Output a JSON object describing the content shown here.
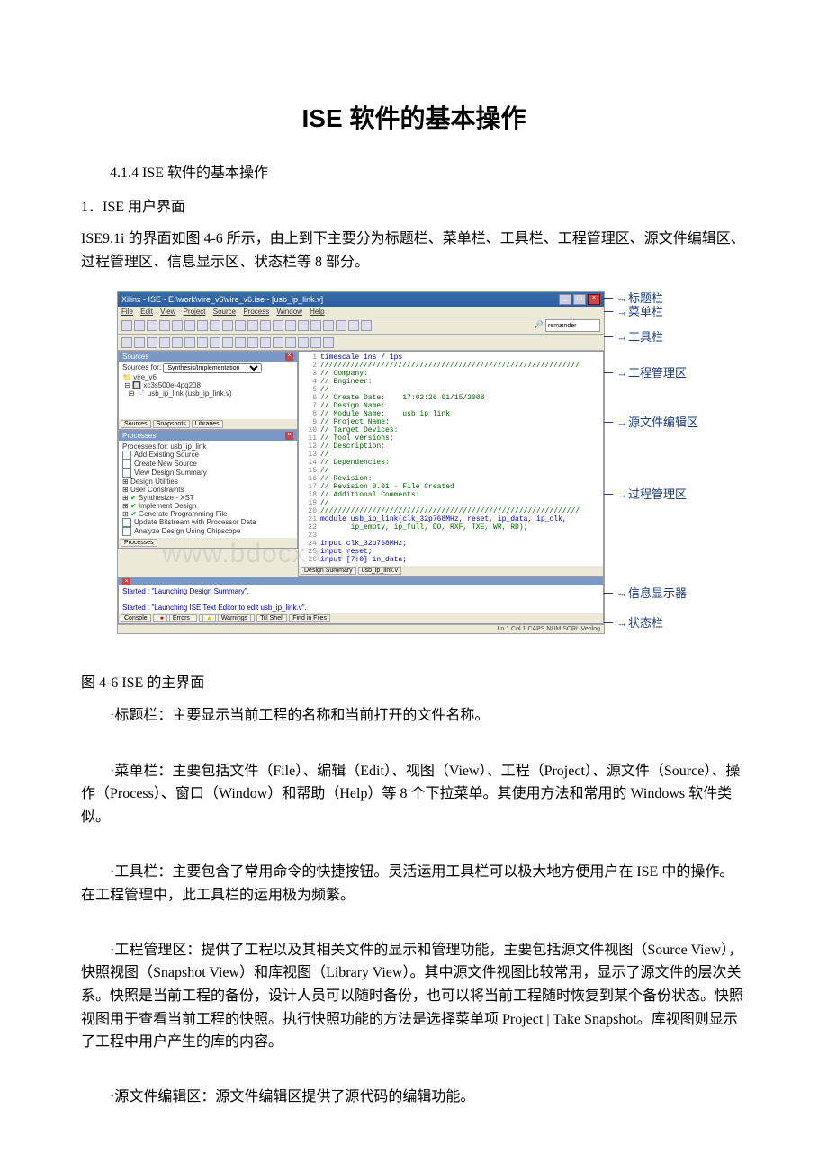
{
  "title": "ISE 软件的基本操作",
  "section_label": "4.1.4 ISE 软件的基本操作",
  "intro1": "1．ISE 用户界面",
  "intro2": "ISE9.1i 的界面如图 4-6 所示，由上到下主要分为标题栏、菜单栏、工具栏、工程管理区、源文件编辑区、过程管理区、信息显示区、状态栏等 8 部分。",
  "figure": {
    "titlebar": "Xilinx - ISE - E:\\work\\vire_v6\\vire_v6.ise - [usb_ip_link.v]",
    "menus": [
      "File",
      "Edit",
      "View",
      "Project",
      "Source",
      "Process",
      "Window",
      "Help"
    ],
    "find_label": "remainder",
    "sources": {
      "pane_title": "Sources",
      "for_label": "Sources for:",
      "for_value": "Synthesis/Implementation",
      "tree": [
        "vire_v6",
        "xc3s500e-4pq208",
        "usb_ip_link (usb_ip_link.v)"
      ],
      "tabs": [
        "Sources",
        "Snapshots",
        "Libraries"
      ]
    },
    "processes": {
      "pane_title": "Processes",
      "for_label": "Processes for: usb_ip_link",
      "items": [
        "Add Existing Source",
        "Create New Source",
        "View Design Summary",
        "Design Utilities",
        "User Constraints",
        "Synthesize - XST",
        "Implement Design",
        "Generate Programming File",
        "Update Bitstream with Processor Data",
        "Analyze Design Using Chipscope"
      ],
      "tabs": [
        "Processes"
      ]
    },
    "code_lines": [
      "timescale 1ns / 1ps",
      "////////////////////////////////////////////////////////////",
      "// Company:",
      "// Engineer:",
      "//",
      "// Create Date:    17:02:26 01/15/2008",
      "// Design Name:",
      "// Module Name:    usb_ip_link",
      "// Project Name:",
      "// Target Devices:",
      "// Tool versions:",
      "// Description:",
      "//",
      "// Dependencies:",
      "//",
      "// Revision:",
      "// Revision 0.01 - File Created",
      "// Additional Comments:",
      "//",
      "////////////////////////////////////////////////////////////",
      "module usb_ip_link(clk_32p768MHz, reset, ip_data, ip_clk,",
      "       ip_empty, ip_full, DO, RXF, TXE, WR, RD);",
      "",
      "input clk_32p768MHz;",
      "input reset;",
      "input [7:0] in_data;"
    ],
    "editor_tabs": [
      "Design Summary",
      "usb_ip_link.v"
    ],
    "console": {
      "line1": "Started : \"Launching Design Summary\".",
      "line2": "Started : \"Launching ISE Text Editor to edit usb_ip_link.v\".",
      "tabs": [
        "Console",
        "Errors",
        "Warnings",
        "Tcl Shell",
        "Find in Files"
      ]
    },
    "status": "Ln 1 Col 1  CAPS  NUM  SCRL  Verilog",
    "callouts": {
      "c1": "标题栏",
      "c2": "菜单栏",
      "c3": "工具栏",
      "c4": "工程管理区",
      "c5": "源文件编辑区",
      "c6": "过程管理区",
      "c7": "信息显示器",
      "c8": "状态栏"
    },
    "watermark": "www.bdocx.com"
  },
  "caption": "图 4-6 ISE 的主界面",
  "bullets": {
    "b1": "·标题栏：主要显示当前工程的名称和当前打开的文件名称。",
    "b2": "·菜单栏：主要包括文件（File）、编辑（Edit）、视图（View）、工程（Project）、源文件（Source）、操作（Process）、窗口（Window）和帮助（Help）等 8 个下拉菜单。其使用方法和常用的 Windows 软件类似。",
    "b3": "·工具栏：主要包含了常用命令的快捷按钮。灵活运用工具栏可以极大地方便用户在 ISE 中的操作。在工程管理中，此工具栏的运用极为频繁。",
    "b4": "·工程管理区：提供了工程以及其相关文件的显示和管理功能，主要包括源文件视图（Source View），快照视图（Snapshot View）和库视图（Library View）。其中源文件视图比较常用，显示了源文件的层次关系。快照是当前工程的备份，设计人员可以随时备份，也可以将当前工程随时恢复到某个备份状态。快照视图用于查看当前工程的快照。执行快照功能的方法是选择菜单项 Project | Take Snapshot。库视图则显示了工程中用户产生的库的内容。",
    "b5": "·源文件编辑区：源文件编辑区提供了源代码的编辑功能。"
  }
}
